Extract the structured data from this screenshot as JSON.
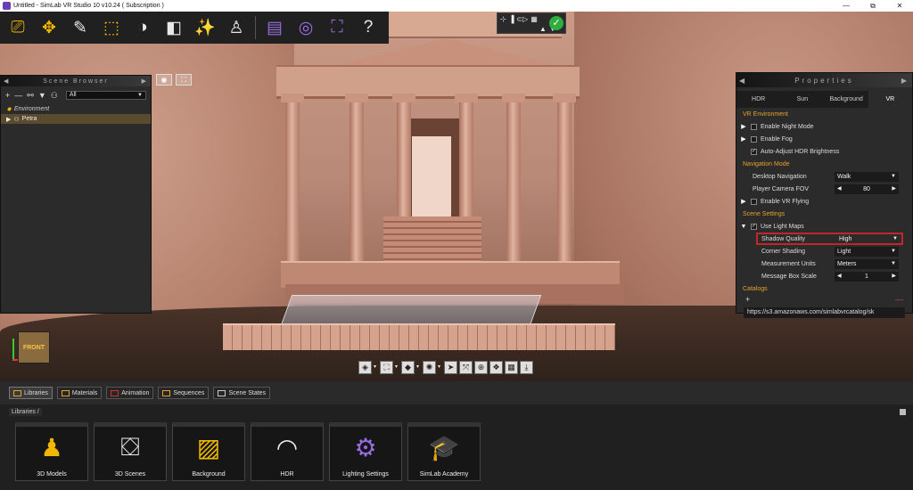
{
  "window": {
    "title": "Untitled - SimLab VR Studio 10 v10.24 ( Subscription )",
    "controls": [
      "—",
      "⧉",
      "✕"
    ]
  },
  "toolbar": {
    "buttons": [
      {
        "name": "open-button",
        "glyph": "⎚",
        "icon": "open-folder-icon",
        "color": "gold"
      },
      {
        "name": "transform-button",
        "glyph": "✥",
        "icon": "move-arrows-icon",
        "color": "gold"
      },
      {
        "name": "edit-button",
        "glyph": "✎",
        "icon": "pencil-icon",
        "color": "white"
      },
      {
        "name": "selection-button",
        "glyph": "⬚",
        "icon": "selection-box-icon",
        "color": "gold"
      },
      {
        "name": "material-button",
        "glyph": "◑",
        "icon": "material-sphere-icon",
        "color": "white"
      },
      {
        "name": "animation-button",
        "glyph": "◧",
        "icon": "animation-icon",
        "color": "white"
      },
      {
        "name": "effects-button",
        "glyph": "✨",
        "icon": "magic-wand-icon",
        "color": "purple"
      },
      {
        "name": "export-button",
        "glyph": "♙",
        "icon": "pawn-icon",
        "color": "white"
      },
      {
        "name": "scene-states-button",
        "glyph": "▤",
        "icon": "scene-states-icon",
        "color": "purple"
      },
      {
        "name": "vr-button",
        "glyph": "◎",
        "icon": "vr-headset-icon",
        "color": "purple"
      },
      {
        "name": "presenter-button",
        "glyph": "⛶",
        "icon": "presenter-icon",
        "color": "purple"
      },
      {
        "name": "help-button",
        "glyph": "?",
        "icon": "help-icon",
        "color": "white"
      }
    ]
  },
  "viewnav": {
    "glyphs": [
      "⊹",
      "▐",
      "⊂▷",
      "▦",
      "▲",
      "▼"
    ],
    "check": "✓"
  },
  "scene_browser": {
    "title": "Scene Browser",
    "tools": [
      "+",
      "—",
      "⚯",
      "▼",
      "⚇"
    ],
    "filter_value": "All",
    "tree": [
      {
        "label": "Environment",
        "icon": "star-icon"
      },
      {
        "label": "Petra",
        "icon": "group-icon"
      }
    ]
  },
  "viewcube": {
    "label": "FRONT"
  },
  "vp_toolbar": {
    "glyphs": [
      "◈",
      "⛶",
      "◆",
      "✺",
      "➤",
      "⤧",
      "⊕",
      "❖",
      "▦",
      "⤓"
    ]
  },
  "properties": {
    "title": "Properties",
    "tabs": [
      "HDR",
      "Sun",
      "Background",
      "VR"
    ],
    "active_tab": "VR",
    "sections": {
      "vr_env": "VR Environment",
      "enable_night": "Enable Night Mode",
      "enable_fog": "Enable Fog",
      "auto_adjust": "Auto-Adjust HDR Brightness",
      "nav_mode": "Navigation Mode",
      "desktop_nav": "Desktop Navigation",
      "desktop_nav_value": "Walk",
      "fov": "Player Camera FOV",
      "fov_value": "80",
      "vr_flying": "Enable VR Flying",
      "scene_settings": "Scene Settings",
      "light_maps": "Use Light Maps",
      "shadow_quality": "Shadow Quality",
      "shadow_quality_value": "High",
      "corner_shading": "Corner Shading",
      "corner_shading_value": "Light",
      "units": "Measurement Units",
      "units_value": "Meters",
      "box_scale": "Message Box Scale",
      "box_scale_value": "1",
      "catalogs": "Catalogs",
      "catalog_url": "https://s3.amazonaws.com/simlabvrcatalog/sk"
    },
    "accent": "#e6a12e",
    "highlight": "#c3262a"
  },
  "libraries": {
    "tabs": [
      "Libraries",
      "Materials",
      "Animation",
      "Sequences",
      "Scene States"
    ],
    "breadcrumb": "Libraries  /",
    "items": [
      {
        "label": "3D Models",
        "glyph": "♟",
        "color": "gold"
      },
      {
        "label": "3D Scenes",
        "glyph": "⛋",
        "color": "white"
      },
      {
        "label": "Background",
        "glyph": "▨",
        "color": "gold"
      },
      {
        "label": "HDR",
        "glyph": "◠",
        "color": "white"
      },
      {
        "label": "Lighting Settings",
        "glyph": "⚙",
        "color": "purple"
      },
      {
        "label": "SimLab Academy",
        "glyph": "🎓",
        "color": "purple"
      }
    ]
  }
}
